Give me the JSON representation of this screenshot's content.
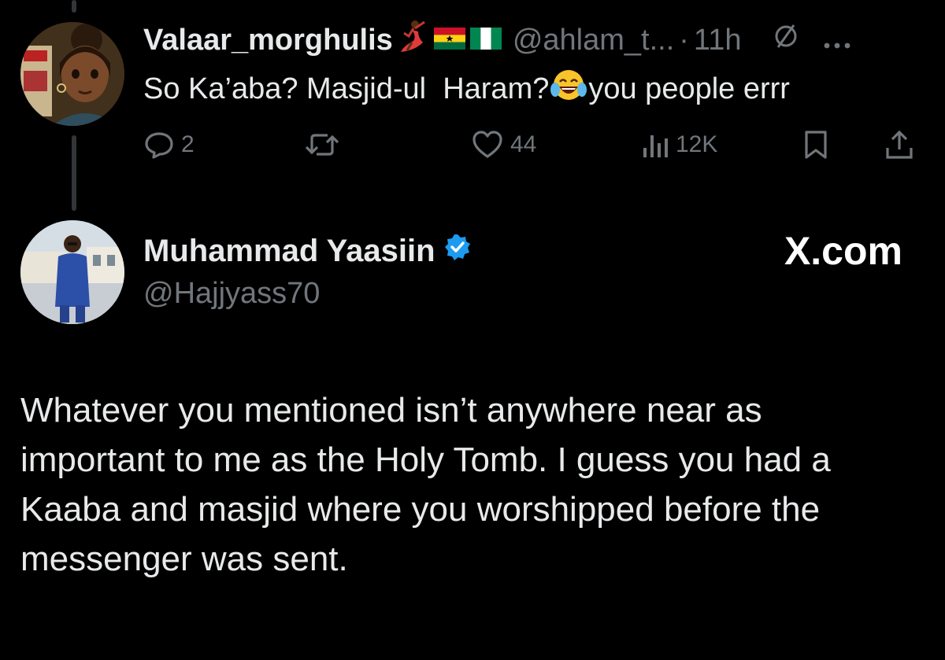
{
  "reply_tweet": {
    "display_name": "Valaar_morghulis",
    "handle": "@ahlam_t...",
    "separator": "·",
    "time": "11h",
    "text": "So Ka’aba? Masjid-ul  Haram?",
    "text_suffix": "you people errr",
    "emoji_icons": [
      "dancer-emoji-icon",
      "ghana-flag-icon",
      "nigeria-flag-icon",
      "laughing-tears-emoji-icon"
    ],
    "actions": {
      "replies": "2",
      "reposts": "",
      "likes": "44",
      "views": "12K"
    }
  },
  "main_tweet": {
    "display_name": "Muhammad Yaasiin",
    "verified": true,
    "handle": "@Hajjyass70",
    "site_label": "X.com",
    "text": "Whatever you mentioned isn’t anywhere near as important to me as the Holy Tomb. I guess you had a Kaaba and masjid where you worshipped before the messenger was sent."
  },
  "colors": {
    "background": "#000000",
    "primary_text": "#e7e9ea",
    "secondary_text": "#71767b",
    "verified_blue": "#1d9bf0",
    "thread_line": "#333639"
  }
}
